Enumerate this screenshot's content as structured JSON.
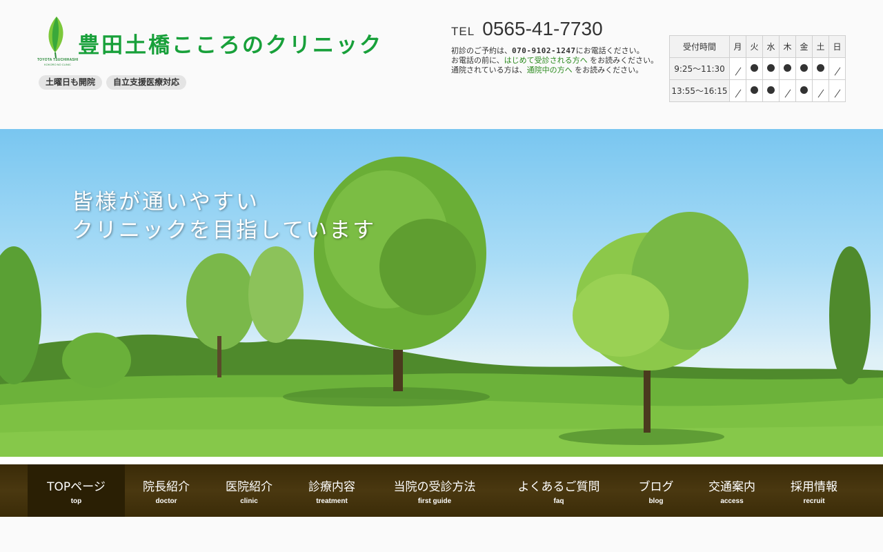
{
  "brand": {
    "title": "豊田土橋こころのクリニック",
    "romaji": "TOYOTA TSUCHIHASHI",
    "romaji_sub": "KOKORO NO CLINIC",
    "color": "#18a03a"
  },
  "badges": [
    "土曜日も開院",
    "自立支援医療対応"
  ],
  "contact": {
    "tel_label": "TEL",
    "tel_number": "0565-41-7730",
    "line1_a": "初診のご予約は、",
    "line1_phone": "070-9102-1247",
    "line1_b": "にお電話ください。",
    "line2_a": "お電話の前に、",
    "line2_link": "はじめて受診される方へ",
    "line2_b": " をお読みください。",
    "line3_a": "通院されている方は、",
    "line3_link": "通院中の方へ",
    "line3_b": " をお読みください。"
  },
  "hours": {
    "header_label": "受付時間",
    "days": [
      "月",
      "火",
      "水",
      "木",
      "金",
      "土",
      "日"
    ],
    "rows": [
      {
        "time": "9:25〜11:30",
        "open": [
          false,
          true,
          true,
          true,
          true,
          true,
          false
        ]
      },
      {
        "time": "13:55〜16:15",
        "open": [
          false,
          true,
          true,
          false,
          true,
          false,
          false
        ]
      }
    ]
  },
  "hero": {
    "line1": "皆様が通いやすい",
    "line2": "クリニックを目指しています"
  },
  "nav": [
    {
      "label": "TOPページ",
      "sub": "top",
      "active": true
    },
    {
      "label": "院長紹介",
      "sub": "doctor",
      "active": false
    },
    {
      "label": "医院紹介",
      "sub": "clinic",
      "active": false
    },
    {
      "label": "診療内容",
      "sub": "treatment",
      "active": false
    },
    {
      "label": "当院の受診方法",
      "sub": "first guide",
      "active": false
    },
    {
      "label": "よくあるご質問",
      "sub": "faq",
      "active": false
    },
    {
      "label": "ブログ",
      "sub": "blog",
      "active": false
    },
    {
      "label": "交通案内",
      "sub": "access",
      "active": false
    },
    {
      "label": "採用情報",
      "sub": "recruit",
      "active": false
    }
  ],
  "colors": {
    "link": "#2b8a1e",
    "nav_bg": "#4a3810",
    "nav_active": "#2a1f04"
  }
}
